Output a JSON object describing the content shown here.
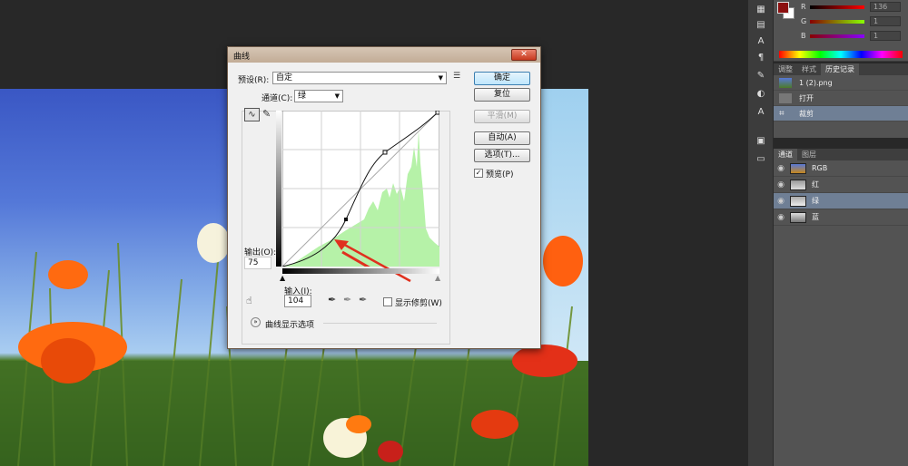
{
  "dialog": {
    "title": "曲线",
    "close": "✕",
    "preset_label": "预设(R):",
    "preset_value": "自定",
    "channel_label": "通道(C):",
    "channel_value": "绿",
    "output_label": "输出(O):",
    "output_value": "75",
    "input_label": "输入(I):",
    "input_value": "104",
    "show_clipping_label": "显示修剪(W)",
    "curve_options_label": "曲线显示选项",
    "buttons": {
      "ok": "确定",
      "reset": "复位",
      "smooth": "平滑(M)",
      "auto": "自动(A)",
      "options": "选项(T)...",
      "preview": "预览(P)"
    }
  },
  "color_panel": {
    "fg_color": "#8c1010",
    "r_label": "R",
    "r_value": "136",
    "g_label": "G",
    "g_value": "1",
    "b_label": "B",
    "b_value": "1"
  },
  "history_panel": {
    "tabs": [
      "调整",
      "样式",
      "历史记录"
    ],
    "items": [
      {
        "label": "1 (2).png"
      },
      {
        "label": "打开"
      },
      {
        "label": "裁剪"
      }
    ]
  },
  "channels_panel": {
    "tabs": [
      "通道",
      "图层"
    ],
    "channels": [
      {
        "label": "RGB"
      },
      {
        "label": "红"
      },
      {
        "label": "绿"
      },
      {
        "label": "蓝"
      }
    ]
  },
  "colors": {
    "histogram": "#b6f2a8",
    "arrow": "#e0301e",
    "titlebar": "#c8b29c"
  }
}
